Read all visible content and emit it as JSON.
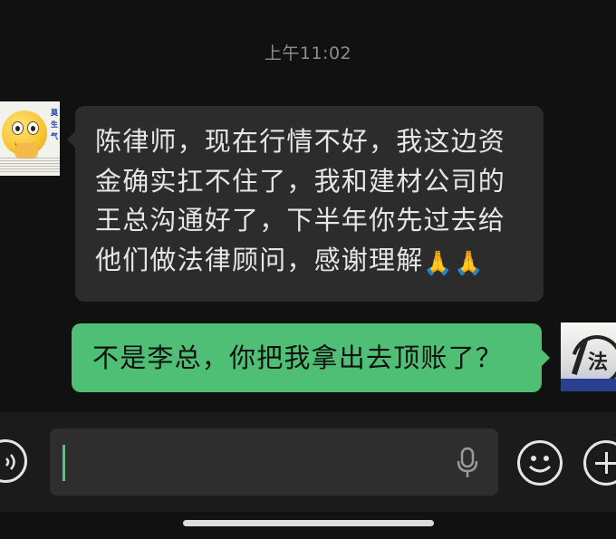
{
  "timestamp": "上午11:02",
  "messages": [
    {
      "side": "received",
      "lines": [
        "陈律师，现在行情不好，我这边资",
        "金确实扛不住了，我和建材公司的",
        "王总沟通好了，下半年你先过去给",
        "他们做法律顾问，感谢理解"
      ],
      "emojis": [
        "🙏",
        "🙏"
      ]
    },
    {
      "side": "sent",
      "text": "不是李总，你把我拿出去顶账了？"
    }
  ],
  "avatars": {
    "left_caption": "莫生气",
    "right_caption": "法"
  },
  "input_bar": {
    "input_value": "",
    "icons": [
      "voice-icon",
      "mic-icon",
      "emoji-icon",
      "plus-icon"
    ]
  },
  "colors": {
    "background": "#111111",
    "received_bubble": "#2c2c2c",
    "sent_bubble": "#4fbf75",
    "caret": "#3dd26b"
  }
}
